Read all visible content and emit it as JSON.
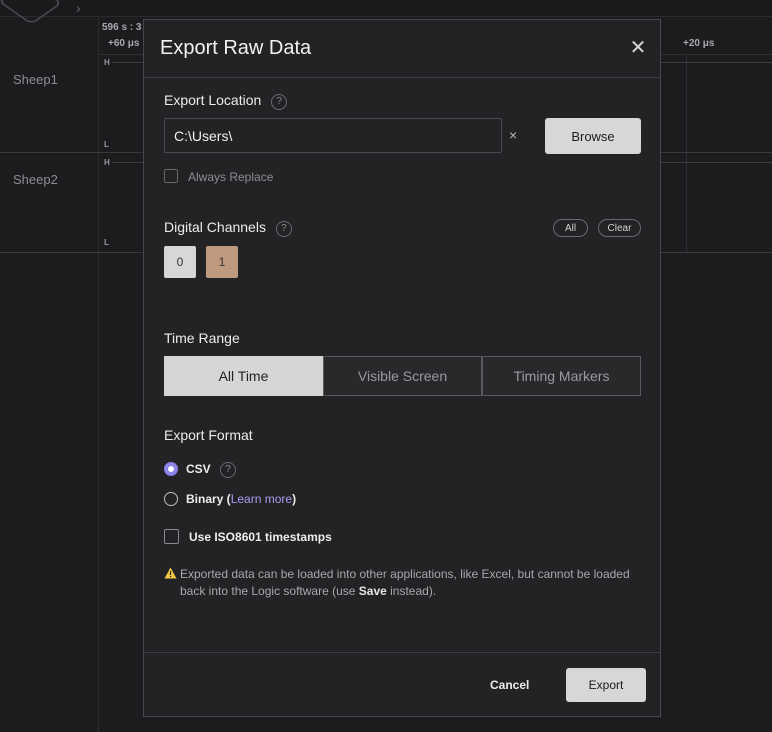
{
  "background": {
    "tick_left": "596 s : 3",
    "tick_plus60": "+60 μs",
    "tick_plus20": "+20 μs",
    "channels": [
      "Sheep1",
      "Sheep2"
    ],
    "high_marker": "H",
    "low_marker": "L"
  },
  "dialog": {
    "title": "Export Raw Data",
    "close_label": "✕",
    "export_location": {
      "label": "Export Location",
      "help": "?",
      "path_value": "C:\\Users\\",
      "clear_label": "×",
      "browse_label": "Browse",
      "always_replace_label": "Always Replace"
    },
    "digital_channels": {
      "label": "Digital Channels",
      "help": "?",
      "all_label": "All",
      "clear_label": "Clear",
      "channels": [
        "0",
        "1"
      ]
    },
    "time_range": {
      "label": "Time Range",
      "options": [
        "All Time",
        "Visible Screen",
        "Timing Markers"
      ],
      "selected": "All Time"
    },
    "export_format": {
      "label": "Export Format",
      "csv_label": "CSV",
      "csv_help": "?",
      "binary_label": "Binary (",
      "binary_link": "Learn more",
      "binary_suffix": ")",
      "iso_label": "Use ISO8601 timestamps"
    },
    "warning": {
      "part1": "Exported data can be loaded into other applications, like Excel, but cannot be loaded back into the Logic software (use ",
      "bold": "Save",
      "part2": " instead)."
    },
    "footer": {
      "cancel_label": "Cancel",
      "export_label": "Export"
    }
  },
  "colors": {
    "accent": "#8a7ee8",
    "channel1_color": "#c09a7e",
    "channel0_color": "#d7d7d7"
  }
}
